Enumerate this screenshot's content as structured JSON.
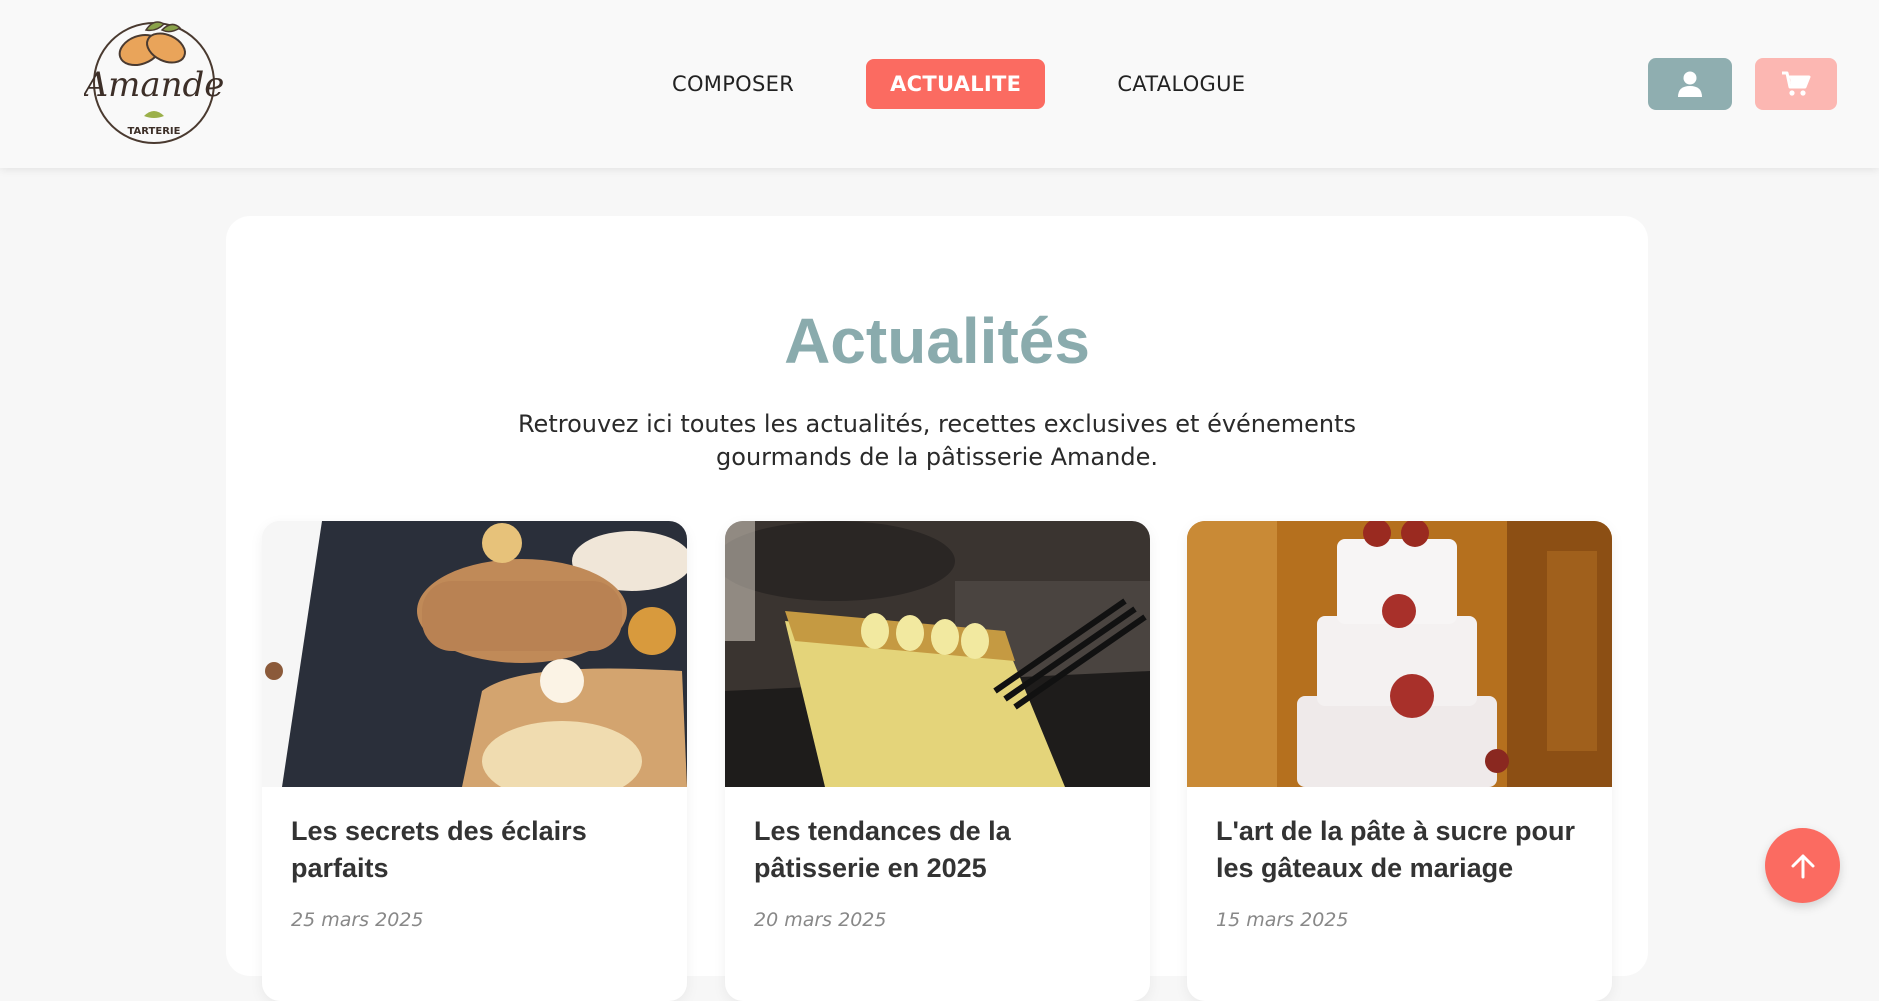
{
  "brand": {
    "name": "Amande",
    "tagline": "TARTERIE"
  },
  "nav": {
    "items": [
      {
        "label": "COMPOSER"
      },
      {
        "label": "ACTUALITE",
        "active": true
      },
      {
        "label": "CATALOGUE"
      }
    ]
  },
  "header_actions": {
    "account_icon": "user-icon",
    "cart_icon": "cart-icon"
  },
  "page": {
    "title": "Actualités",
    "intro": "Retrouvez ici toutes les actualités, recettes exclusives et événements gourmands de la pâtisserie Amande."
  },
  "articles": [
    {
      "title": "Les secrets des éclairs parfaits",
      "date": "25 mars 2025"
    },
    {
      "title": "Les tendances de la pâtisserie en 2025",
      "date": "20 mars 2025"
    },
    {
      "title": "L'art de la pâte à sucre pour les gâteaux de mariage",
      "date": "15 mars 2025"
    }
  ],
  "colors": {
    "accent": "#fb6b61",
    "teal": "#8faeb0",
    "title": "#8aabad",
    "cart": "#fcb7b2"
  },
  "scroll_top_icon": "arrow-up-icon"
}
